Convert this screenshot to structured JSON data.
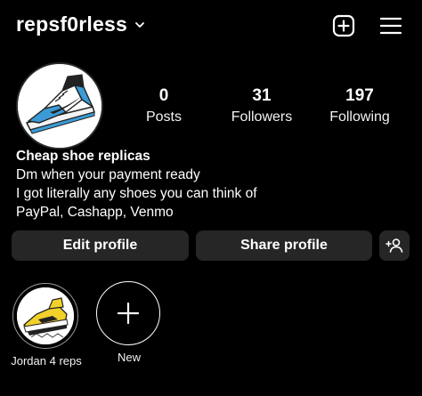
{
  "header": {
    "username": "repsf0rless",
    "icons": [
      "chevron-down-icon",
      "create-post-icon",
      "menu-icon"
    ]
  },
  "profile": {
    "avatar_icon": "sneaker-photo",
    "stats": {
      "posts": {
        "value": "0",
        "label": "Posts"
      },
      "followers": {
        "value": "31",
        "label": "Followers"
      },
      "following": {
        "value": "197",
        "label": "Following"
      }
    },
    "bio": {
      "name": "Cheap shoe replicas",
      "lines": [
        "Dm when your payment ready",
        "I got literally any shoes you can think of",
        "PayPal, Cashapp, Venmo"
      ]
    }
  },
  "actions": {
    "edit_label": "Edit profile",
    "share_label": "Share profile",
    "suggest_icon": "add-person-icon"
  },
  "highlights": [
    {
      "label": "Jordan 4 reps",
      "icon": "yellow-sneaker-photo"
    },
    {
      "label": "New",
      "icon": "plus-icon"
    }
  ],
  "colors": {
    "background": "#000000",
    "button_bg": "#262626",
    "text": "#ffffff"
  }
}
